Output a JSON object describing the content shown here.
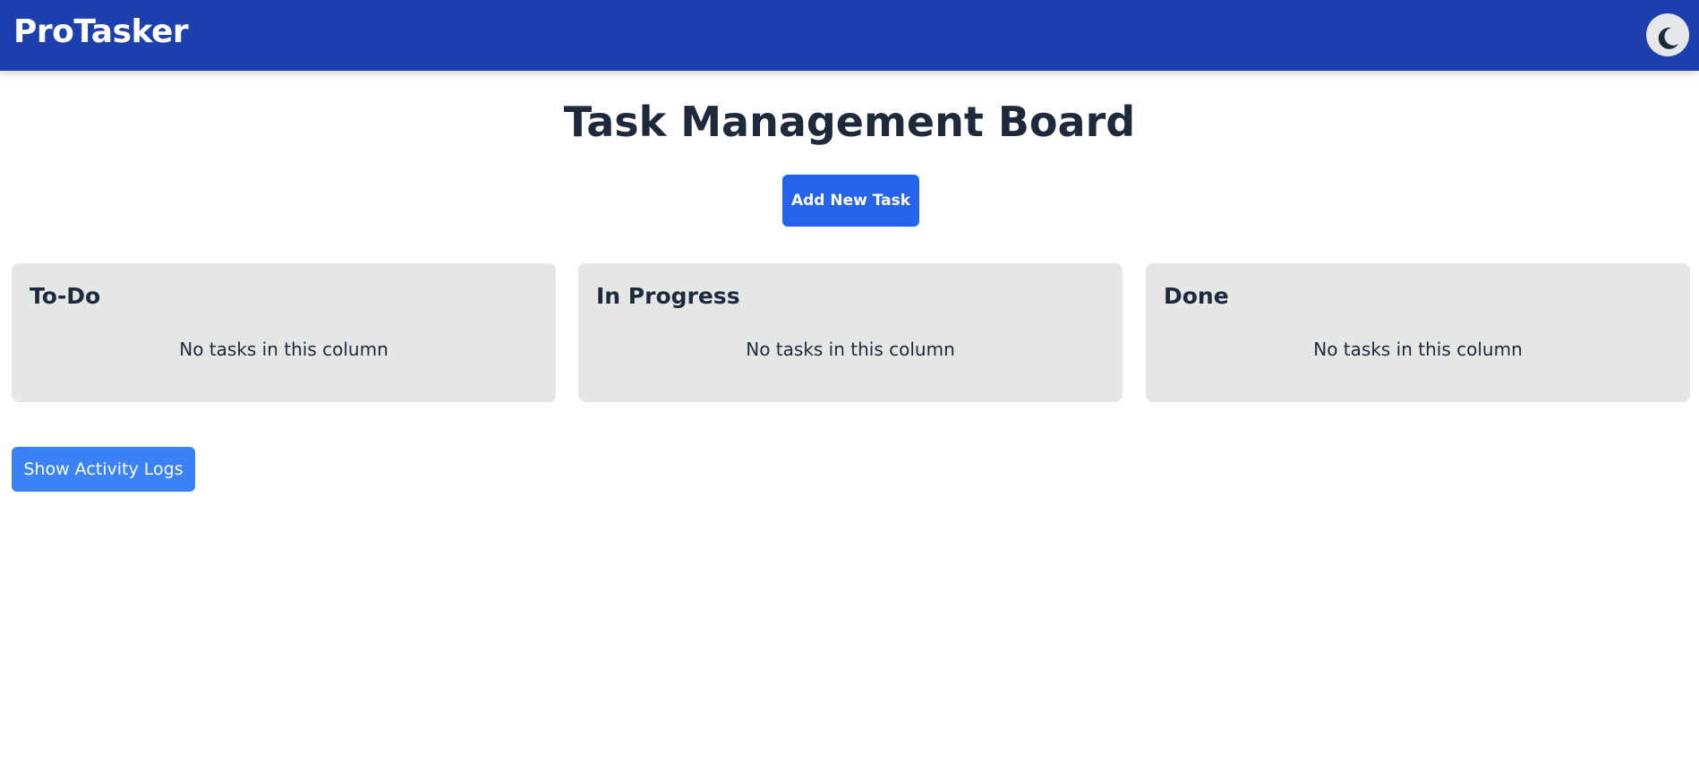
{
  "app": {
    "brand": "ProTasker",
    "theme_toggle_icon": "moon-icon"
  },
  "page": {
    "title": "Task Management Board",
    "add_task_label": "Add New Task",
    "show_logs_label": "Show Activity Logs"
  },
  "columns": [
    {
      "title": "To-Do",
      "empty_text": "No tasks in this column"
    },
    {
      "title": "In Progress",
      "empty_text": "No tasks in this column"
    },
    {
      "title": "Done",
      "empty_text": "No tasks in this column"
    }
  ],
  "colors": {
    "navbar": "#1e40af",
    "primary_button": "#2563eb",
    "secondary_button": "#3b82f6",
    "column_background": "#e5e7e7",
    "text": "#1e293b"
  }
}
